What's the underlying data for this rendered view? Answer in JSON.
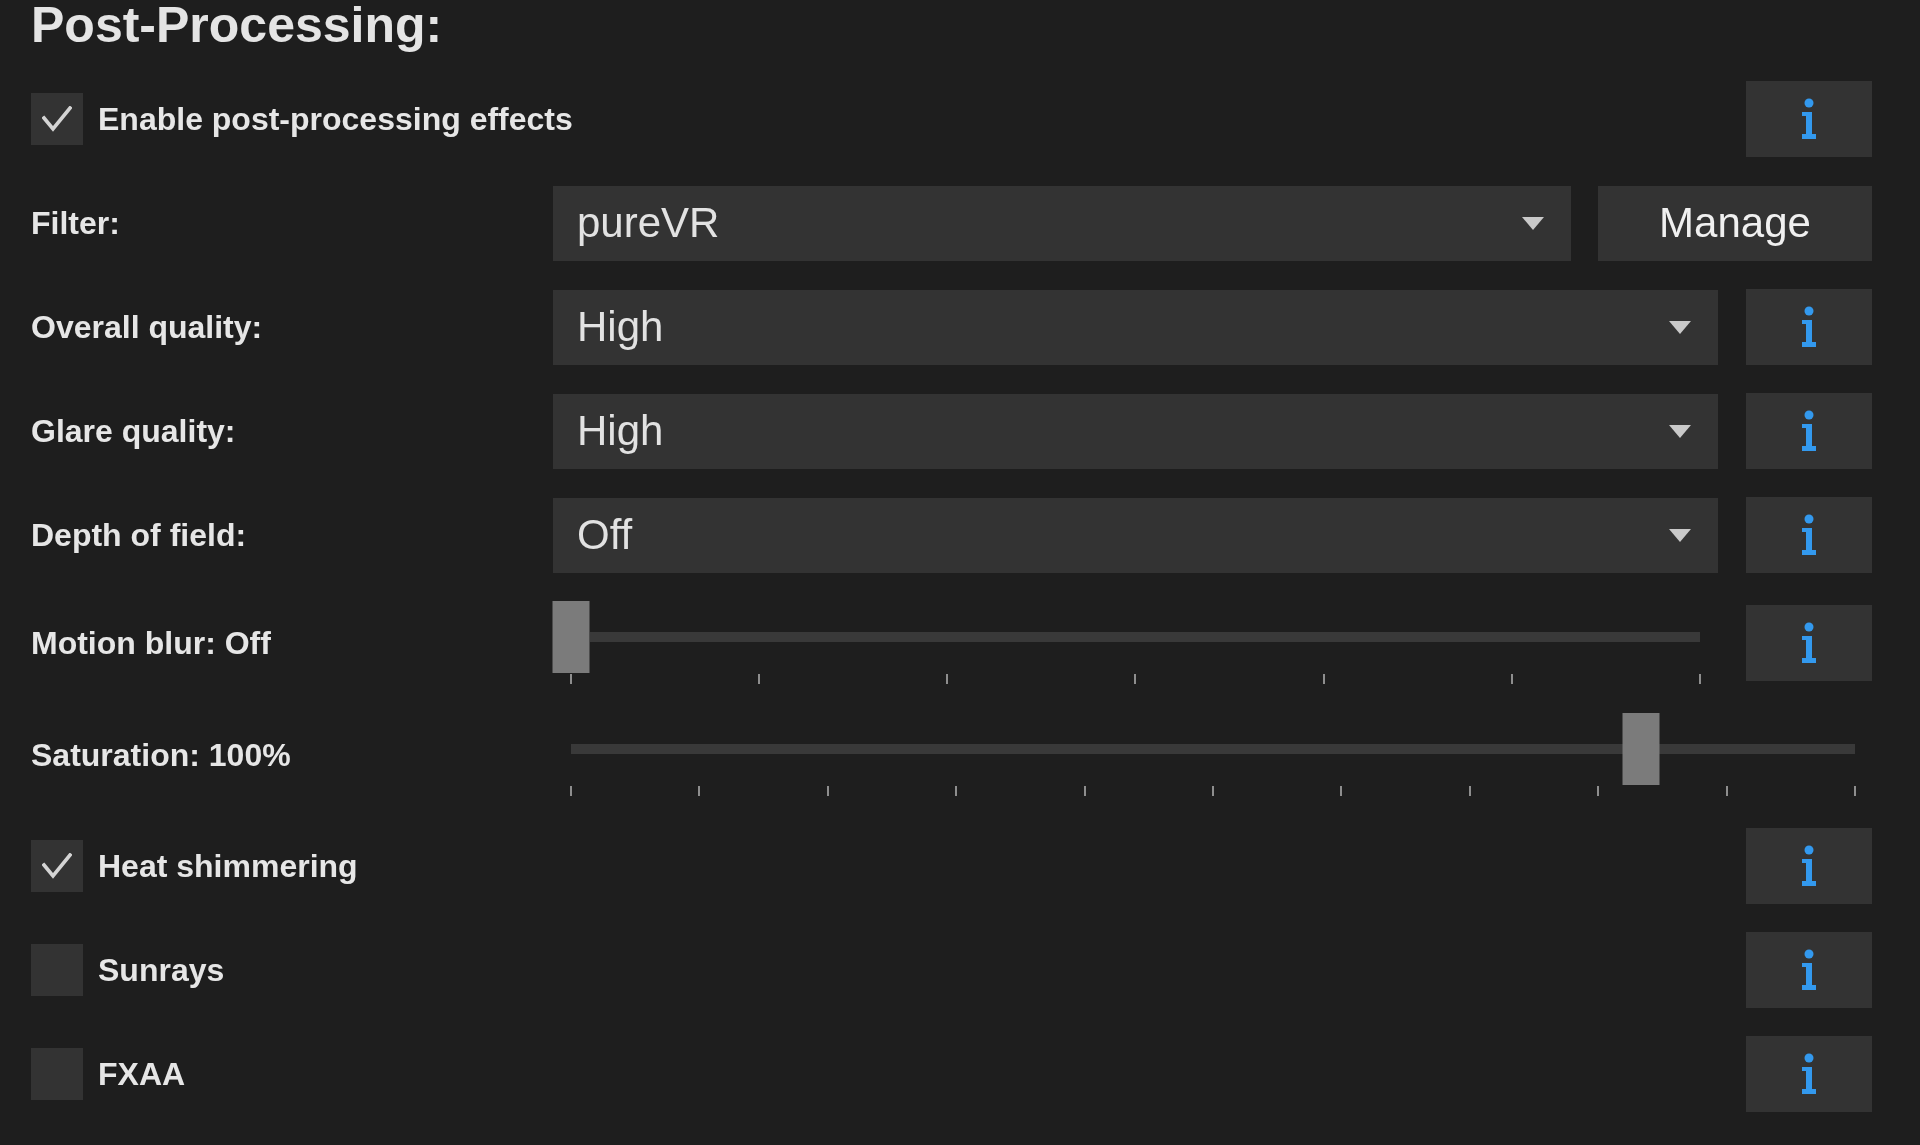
{
  "section": {
    "title": "Post-Processing:"
  },
  "settings": [
    {
      "kind": "checkbox",
      "label": "Enable post-processing effects",
      "checked": true,
      "info": true
    },
    {
      "kind": "dropdown",
      "label": "Filter:",
      "value": "pureVR",
      "button": "Manage"
    },
    {
      "kind": "dropdown",
      "label": "Overall quality:",
      "value": "High",
      "info": true
    },
    {
      "kind": "dropdown",
      "label": "Glare quality:",
      "value": "High",
      "info": true
    },
    {
      "kind": "dropdown",
      "label": "Depth of field:",
      "value": "Off",
      "info": true
    },
    {
      "kind": "slider",
      "label": "Motion blur: Off",
      "level": 0,
      "info": true
    },
    {
      "kind": "slider",
      "label": "Saturation: 100%",
      "level": 0.833,
      "info": false
    },
    {
      "kind": "checkbox",
      "label": "Heat shimmering",
      "checked": true,
      "info": true
    },
    {
      "kind": "checkbox",
      "label": "Sunrays",
      "checked": false,
      "info": true
    },
    {
      "kind": "checkbox",
      "label": "FXAA",
      "checked": false,
      "info": true
    }
  ]
}
